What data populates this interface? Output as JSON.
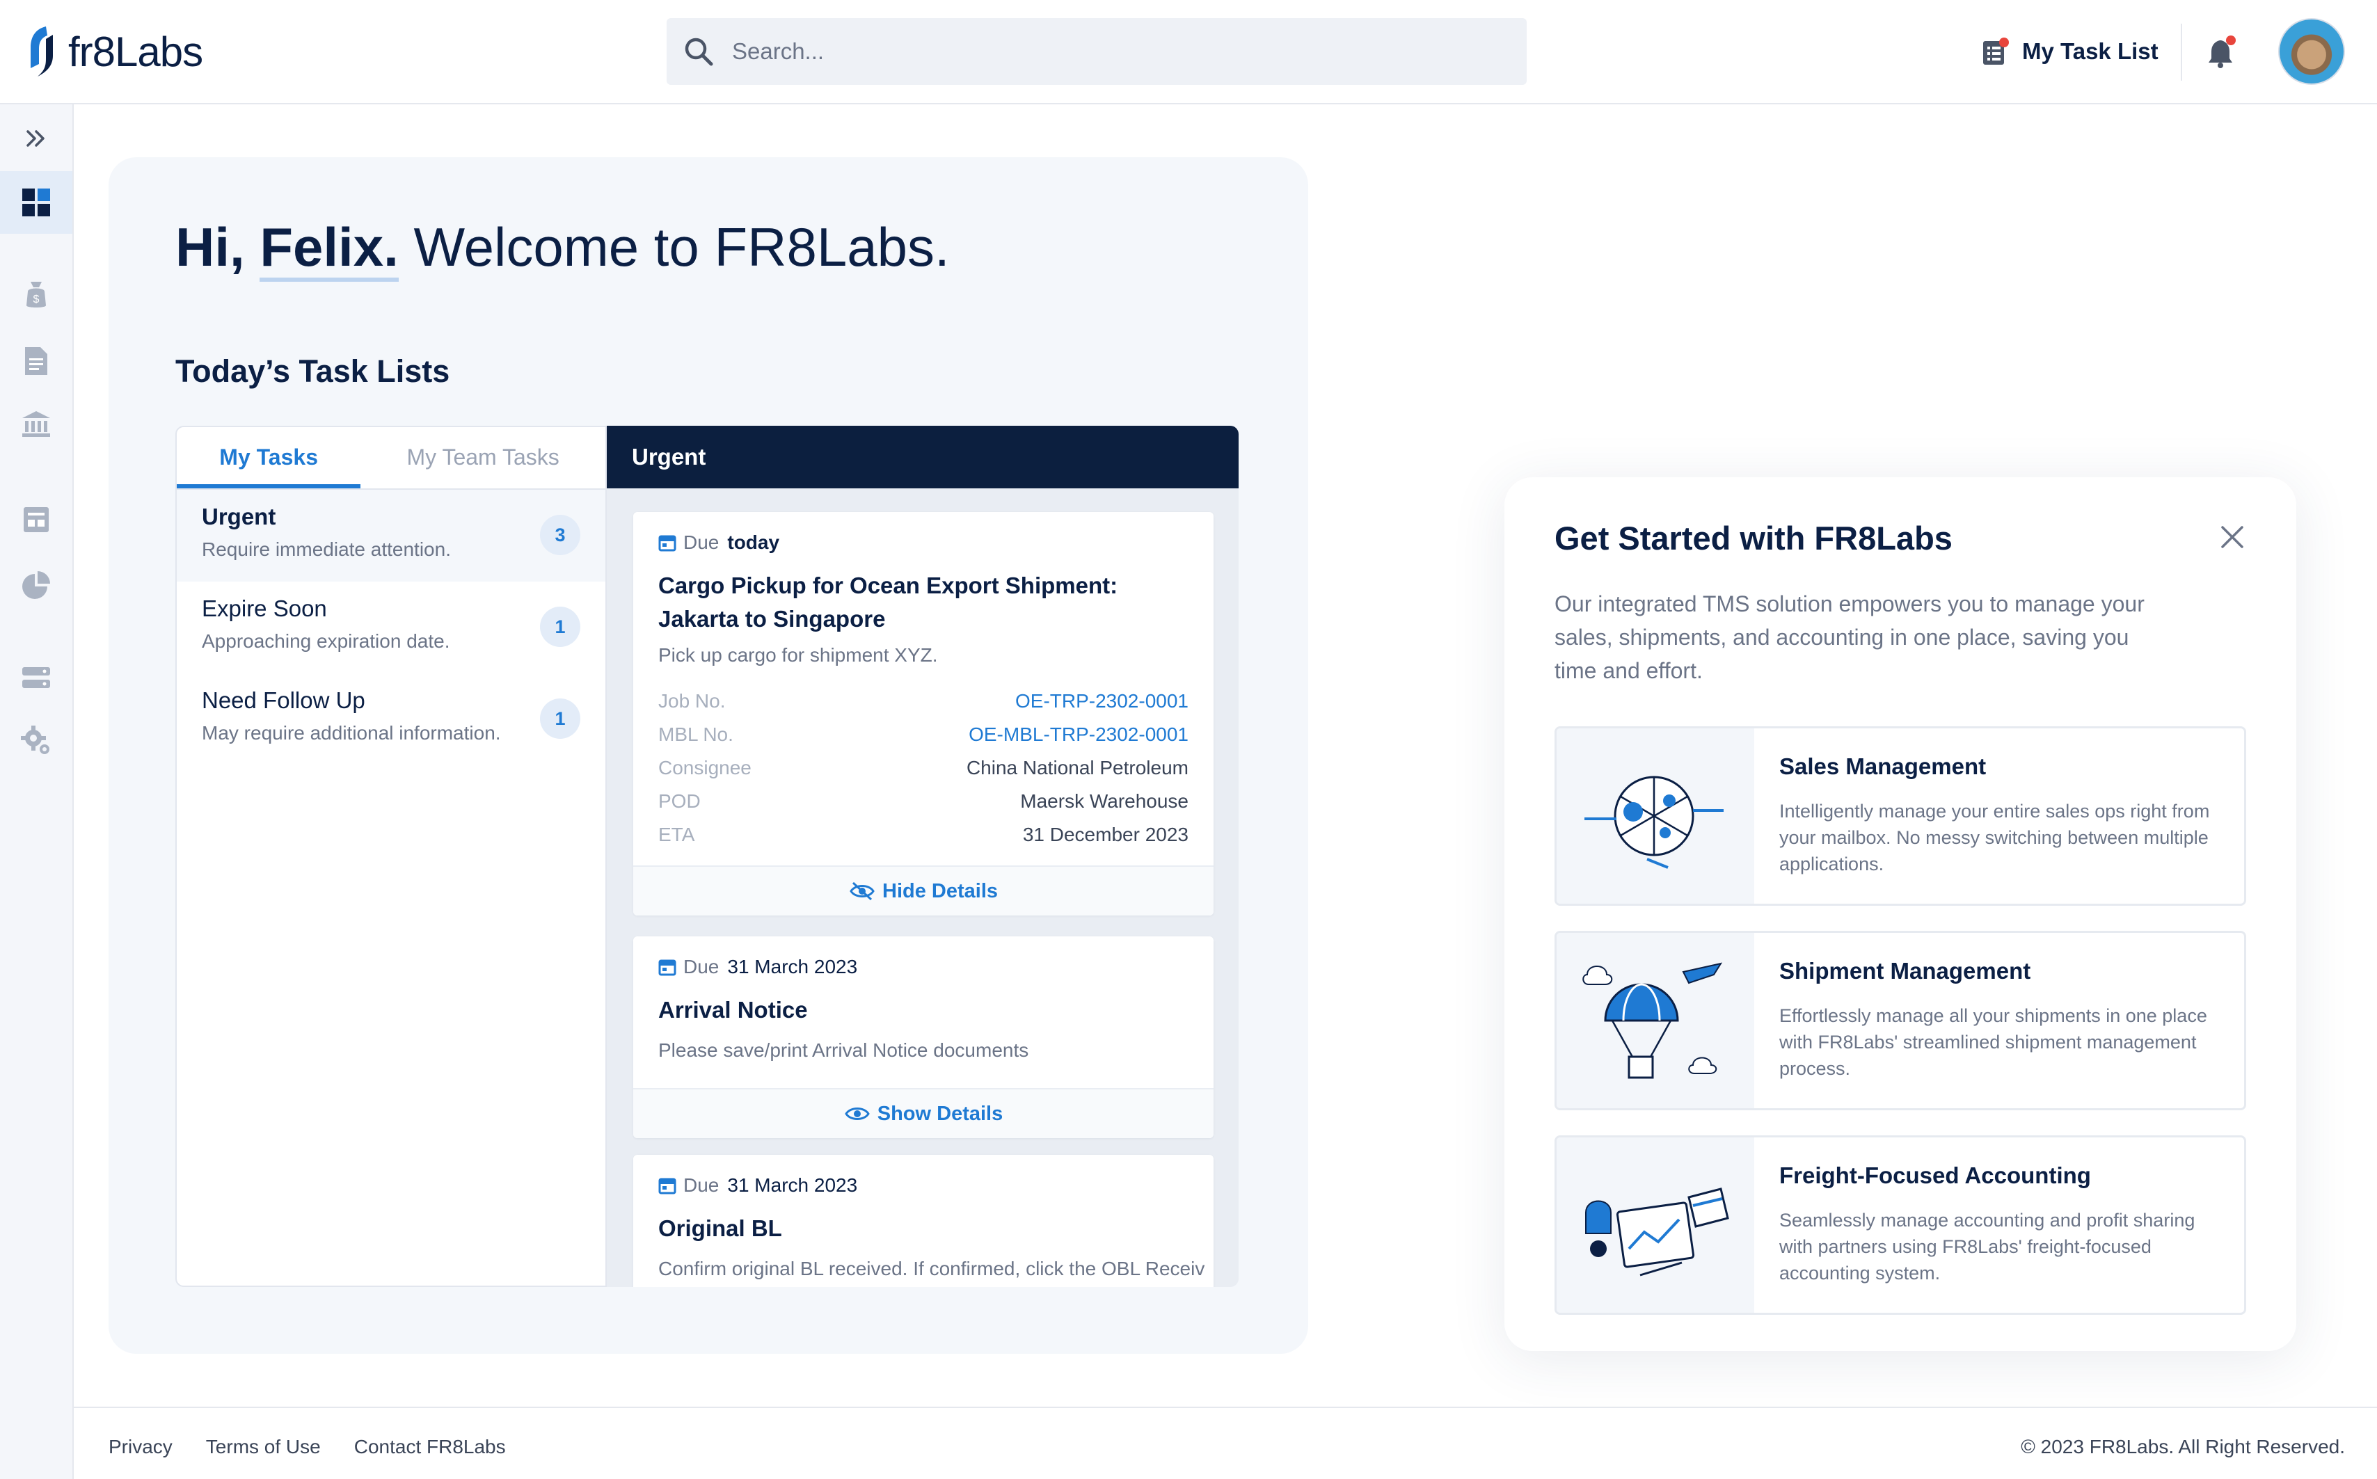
{
  "app": {
    "logo_text": "fr8Labs"
  },
  "header": {
    "search_placeholder": "Search...",
    "task_list_label": "My Task List"
  },
  "sidebar": {
    "items": [
      {
        "name": "expand",
        "icon": "chevrons-right-icon"
      },
      {
        "name": "dashboard",
        "icon": "dashboard-icon",
        "active": true
      },
      {
        "name": "sales",
        "icon": "money-bag-icon"
      },
      {
        "name": "documents",
        "icon": "document-icon"
      },
      {
        "name": "bank",
        "icon": "bank-icon"
      },
      {
        "name": "invoice",
        "icon": "invoice-icon"
      },
      {
        "name": "reports",
        "icon": "pie-chart-icon"
      },
      {
        "name": "database",
        "icon": "server-icon"
      },
      {
        "name": "settings",
        "icon": "gear-icon"
      }
    ]
  },
  "welcome": {
    "greeting_hi": "Hi,",
    "greeting_name": "Felix.",
    "greeting_rest": "Welcome to FR8Labs.",
    "today_title": "Today’s Task Lists"
  },
  "tasks": {
    "tabs": [
      "My Tasks",
      "My Team Tasks"
    ],
    "categories": [
      {
        "title": "Urgent",
        "desc": "Require immediate attention.",
        "count": "3"
      },
      {
        "title": "Expire Soon",
        "desc": "Approaching expiration date.",
        "count": "1"
      },
      {
        "title": "Need Follow Up",
        "desc": "May require additional information.",
        "count": "1"
      }
    ],
    "panel_title": "Urgent",
    "due_label": "Due",
    "cards": [
      {
        "due": "today",
        "title_line1": "Cargo Pickup for Ocean Export Shipment:",
        "title_line2": "Jakarta to Singapore",
        "desc": "Pick up cargo for shipment XYZ.",
        "details": [
          {
            "k": "Job No.",
            "v": "OE-TRP-2302-0001"
          },
          {
            "k": "MBL No.",
            "v": "OE-MBL-TRP-2302-0001"
          },
          {
            "k": "Consignee",
            "v": "China National Petroleum"
          },
          {
            "k": "POD",
            "v": "Maersk Warehouse"
          },
          {
            "k": "ETA",
            "v": "31 December 2023"
          }
        ],
        "action": "Hide Details"
      },
      {
        "due": "31 March 2023",
        "title": "Arrival Notice",
        "desc": "Please save/print Arrival Notice documents",
        "action": "Show Details"
      },
      {
        "due": "31 March 2023",
        "title": "Original BL",
        "desc": "Confirm original BL received. If confirmed, click the OBL Receiv"
      }
    ]
  },
  "get_started": {
    "title": "Get Started with FR8Labs",
    "desc": "Our integrated TMS solution empowers you to manage your sales, shipments, and accounting in one place, saving you time and effort.",
    "features": [
      {
        "title": "Sales Management",
        "desc": "Intelligently manage your entire sales ops right from your mailbox. No messy switching between multiple applications."
      },
      {
        "title": "Shipment Management",
        "desc": "Effortlessly manage all your shipments in one place with FR8Labs' streamlined shipment management process."
      },
      {
        "title": "Freight-Focused Accounting",
        "desc": "Seamlessly manage accounting and profit sharing with partners using FR8Labs' freight-focused accounting system."
      }
    ]
  },
  "footer": {
    "links": [
      "Privacy",
      "Terms of Use",
      "Contact FR8Labs"
    ],
    "copyright": "© 2023 FR8Labs. All Right Reserved."
  },
  "colors": {
    "brand_navy": "#0b1f44",
    "accent_blue": "#1f7ad3",
    "panel_bg": "#f4f7fb"
  }
}
